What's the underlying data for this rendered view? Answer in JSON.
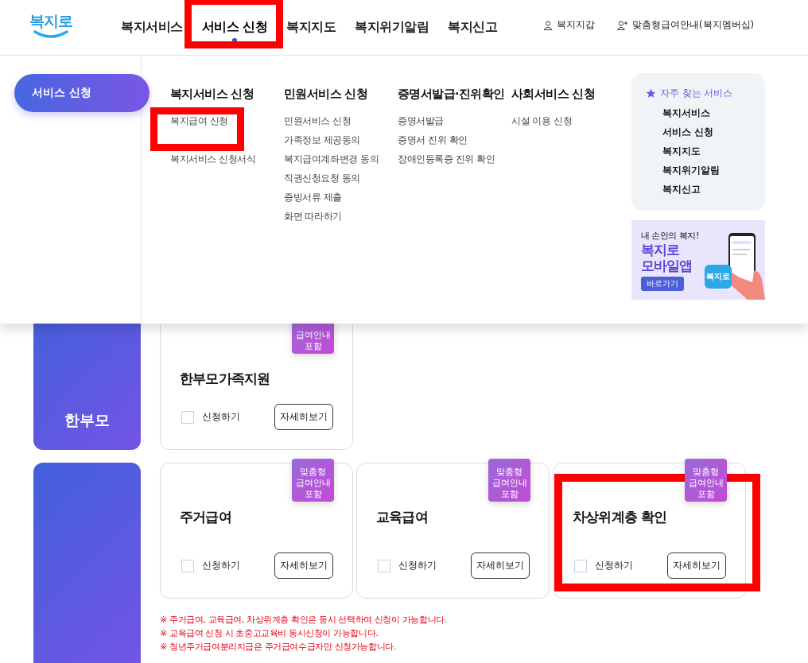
{
  "header": {
    "logo": "복지로",
    "nav": [
      {
        "label": "복지서비스",
        "selected": false,
        "highlight": false
      },
      {
        "label": "서비스 신청",
        "selected": true,
        "highlight": true
      },
      {
        "label": "복지지도",
        "selected": false,
        "highlight": false
      },
      {
        "label": "복지위기알림",
        "selected": false,
        "highlight": false
      },
      {
        "label": "복지신고",
        "selected": false,
        "highlight": false
      }
    ],
    "utility_links": [
      {
        "label": "복지지갑",
        "kind": "user"
      },
      {
        "label": "맞춤형급여안내(복지멤버십)",
        "kind": "user-plus"
      }
    ]
  },
  "mega_menu": {
    "section": "서비스 신청",
    "columns": [
      {
        "heading": "복지서비스 신청",
        "items": [
          {
            "label": "복지급여 신청",
            "highlight": true
          },
          {
            "label": "복지서비스 신청서식",
            "highlight": false
          }
        ]
      },
      {
        "heading": "민원서비스 신청",
        "items": [
          {
            "label": "민원서비스 신청",
            "highlight": false
          },
          {
            "label": "가족정보 제공동의",
            "highlight": false
          },
          {
            "label": "복지급여계좌변경 동의",
            "highlight": false
          },
          {
            "label": "직권신청요청 동의",
            "highlight": false
          },
          {
            "label": "증빙서류 제출",
            "highlight": false
          },
          {
            "label": "화면 따라하기",
            "highlight": false
          }
        ]
      },
      {
        "heading": "증명서발급·진위확인",
        "items": [
          {
            "label": "증명서발급",
            "highlight": false
          },
          {
            "label": "증명서 진위 확인",
            "highlight": false
          },
          {
            "label": "장애인등록증 진위 확인",
            "highlight": false
          }
        ]
      },
      {
        "heading": "사회서비스 신청",
        "items": [
          {
            "label": "시설 이용 신청",
            "highlight": false
          }
        ]
      }
    ],
    "favorites": {
      "title": "자주 찾는 서비스",
      "items": [
        "복지서비스",
        "서비스 신청",
        "복지지도",
        "복지위기알림",
        "복지신고"
      ]
    },
    "banner": {
      "tagline": "내 손안의 복지!",
      "title_lines": [
        "복지로",
        "모바일앱"
      ],
      "button": "바로가기",
      "app_icon": "복지로"
    }
  },
  "groups": [
    {
      "category": "한부모",
      "cards": [
        {
          "title": "한부모가족지원",
          "badge_lines": [
            "급여안내",
            "포함"
          ],
          "checkbox_label": "신청하기",
          "checked": false,
          "button": "자세히보기",
          "highlight": false
        }
      ]
    },
    {
      "cards": [
        {
          "title": "주거급여",
          "badge_lines": [
            "맞춤형",
            "급여안내",
            "포함"
          ],
          "checkbox_label": "신청하기",
          "checked": false,
          "button": "자세히보기",
          "highlight": false
        },
        {
          "title": "교육급여",
          "badge_lines": [
            "맞춤형",
            "급여안내",
            "포함"
          ],
          "checkbox_label": "신청하기",
          "checked": false,
          "button": "자세히보기",
          "highlight": false
        },
        {
          "title": "차상위계층 확인",
          "badge_lines": [
            "맞춤형",
            "급여안내",
            "포함"
          ],
          "checkbox_label": "신청하기",
          "checked": false,
          "button": "자세히보기",
          "highlight": true
        }
      ],
      "notes": [
        "※ 주거급여, 교육급여, 차상위계층 확인은 동시 선택하여 신청이 가능합니다.",
        "※ 교육급여 신청 시 초중고교육비 동시신청이 가능합니다.",
        "※ 청년주거급여분리지급은 주거급여수급자만 신청가능합니다."
      ]
    }
  ]
}
